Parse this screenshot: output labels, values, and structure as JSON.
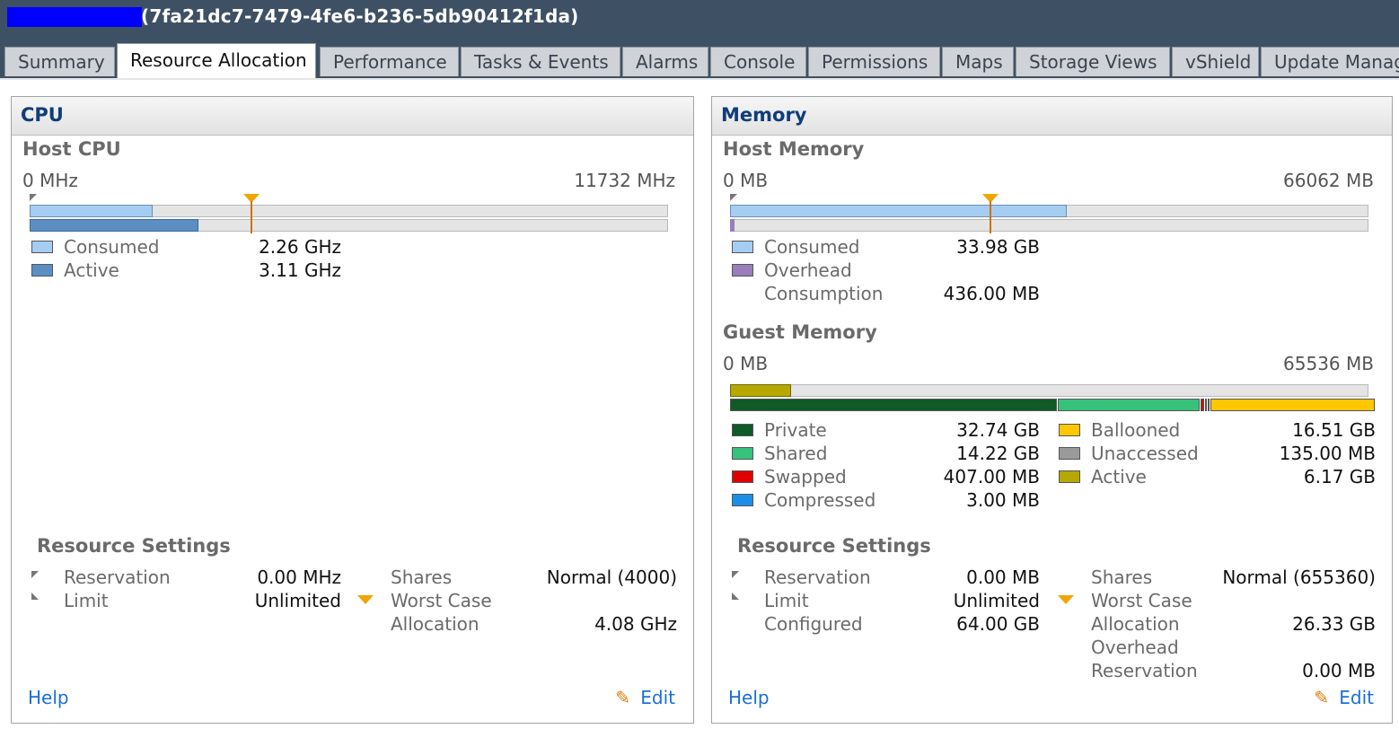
{
  "window": {
    "title": "(7fa21dc7-7479-4fe6-b236-5db90412f1da)"
  },
  "tabs": [
    "Summary",
    "Resource Allocation",
    "Performance",
    "Tasks & Events",
    "Alarms",
    "Console",
    "Permissions",
    "Maps",
    "Storage Views",
    "vShield",
    "Update Manag"
  ],
  "active_tab": "Resource Allocation",
  "cpu": {
    "title": "CPU",
    "host_label": "Host CPU",
    "range_min": "0 MHz",
    "range_max": "11732 MHz",
    "consumed_label": "Consumed",
    "consumed_value": "2.26 GHz",
    "active_label": "Active",
    "active_value": "3.11 GHz",
    "consumed_fraction": 0.193,
    "active_fraction": 0.265,
    "worst_case_fraction": 0.348,
    "settings": {
      "heading": "Resource Settings",
      "reservation_label": "Reservation",
      "reservation_value": "0.00 MHz",
      "limit_label": "Limit",
      "limit_value": "Unlimited",
      "shares_label": "Shares",
      "shares_value": "Normal (4000)",
      "worst_case_label_1": "Worst Case",
      "worst_case_label_2": "Allocation",
      "worst_case_value": "4.08 GHz"
    },
    "help": "Help",
    "edit": "Edit"
  },
  "memory": {
    "title": "Memory",
    "host_label": "Host Memory",
    "range_min": "0 MB",
    "range_max": "66062 MB",
    "consumed_label": "Consumed",
    "consumed_value": "33.98 GB",
    "overhead_label_1": "Overhead",
    "overhead_label_2": "Consumption",
    "overhead_value": "436.00 MB",
    "host_consumed_fraction": 0.527,
    "host_overhead_fraction": 0.0066,
    "host_worst_case_fraction": 0.408,
    "guest_label": "Guest Memory",
    "guest_min": "0 MB",
    "guest_max": "65536 MB",
    "guest_active_fraction": 0.096,
    "guest_segments": [
      {
        "name": "private",
        "fraction": 0.5116,
        "color": "#0f5a26"
      },
      {
        "name": "shared",
        "fraction": 0.2222,
        "color": "#36c27a"
      },
      {
        "name": "swapped",
        "fraction": 0.0062,
        "color": "#e00000"
      },
      {
        "name": "compressed",
        "fraction": 0.0012,
        "color": "#1b8fe6"
      },
      {
        "name": "unaccessed",
        "fraction": 0.0021,
        "color": "#9a9a9a"
      },
      {
        "name": "ballooned",
        "fraction": 0.258,
        "color": "#ffc700"
      }
    ],
    "legend_left": [
      {
        "label": "Private",
        "value": "32.74 GB",
        "color": "#0f5a26"
      },
      {
        "label": "Shared",
        "value": "14.22 GB",
        "color": "#36c27a"
      },
      {
        "label": "Swapped",
        "value": "407.00 MB",
        "color": "#e00000"
      },
      {
        "label": "Compressed",
        "value": "3.00 MB",
        "color": "#1b8fe6"
      }
    ],
    "legend_right": [
      {
        "label": "Ballooned",
        "value": "16.51 GB",
        "color": "#ffc700"
      },
      {
        "label": "Unaccessed",
        "value": "135.00 MB",
        "color": "#9a9a9a"
      },
      {
        "label": "Active",
        "value": "6.17 GB",
        "color": "#b5a800"
      }
    ],
    "settings": {
      "heading": "Resource Settings",
      "reservation_label": "Reservation",
      "reservation_value": "0.00 MB",
      "limit_label": "Limit",
      "limit_value": "Unlimited",
      "configured_label": "Configured",
      "configured_value": "64.00 GB",
      "shares_label": "Shares",
      "shares_value": "Normal (655360)",
      "worst_case_label_1": "Worst Case",
      "worst_case_label_2": "Allocation",
      "worst_case_value": "26.33 GB",
      "overhead_res_label_1": "Overhead",
      "overhead_res_label_2": "Reservation",
      "overhead_res_value": "0.00 MB"
    },
    "help": "Help",
    "edit": "Edit"
  },
  "colors": {
    "consumed": "#a5cdf2",
    "active_cpu": "#5b8fc4",
    "overhead": "#9a7dbb",
    "guest_active": "#b5a800",
    "marker": "#f2a500"
  },
  "icons": {
    "edit": "pencil-icon",
    "worst_case": "worst-case-marker-icon"
  }
}
